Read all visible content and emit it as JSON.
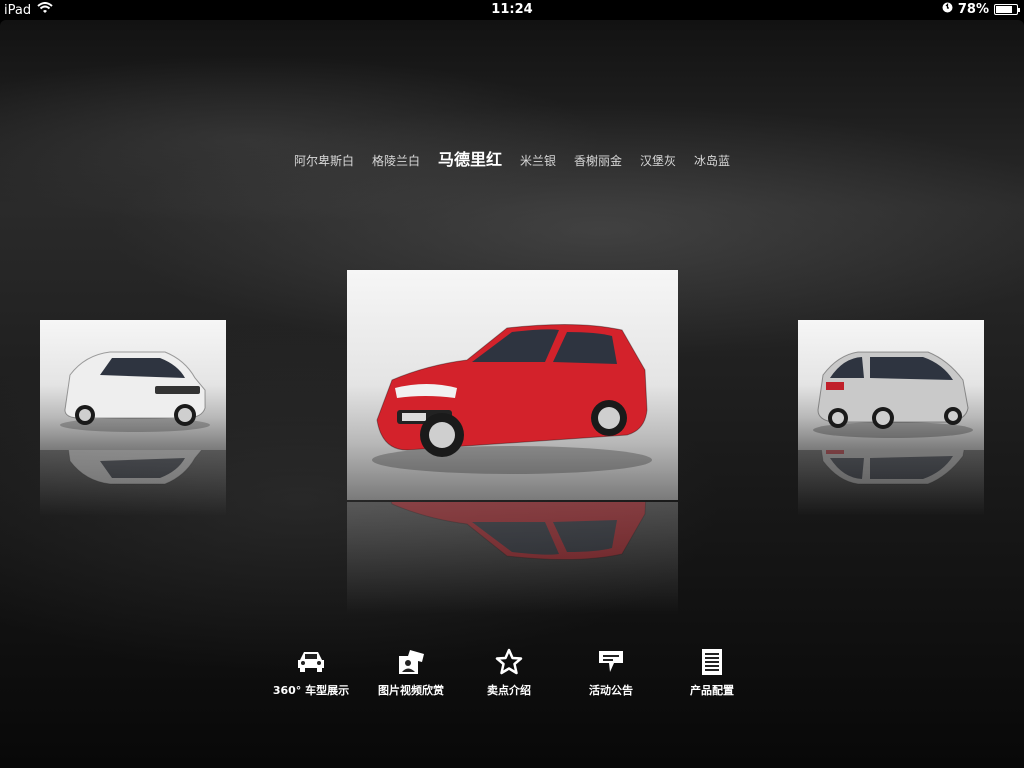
{
  "status_bar": {
    "device": "iPad",
    "time": "11:24",
    "battery_pct": 78,
    "battery_label": "78%"
  },
  "color_options": [
    {
      "label": "阿尔卑斯白",
      "active": false
    },
    {
      "label": "格陵兰白",
      "active": false
    },
    {
      "label": "马德里红",
      "active": true
    },
    {
      "label": "米兰银",
      "active": false
    },
    {
      "label": "香榭丽金",
      "active": false
    },
    {
      "label": "汉堡灰",
      "active": false
    },
    {
      "label": "冰岛蓝",
      "active": false
    }
  ],
  "carousel": {
    "left": {
      "car_color": "#eeeeee"
    },
    "center": {
      "car_color": "#d3222b"
    },
    "right": {
      "car_color": "#c9c9c9"
    }
  },
  "menu": [
    {
      "label": "360° 车型展示",
      "icon": "car-icon"
    },
    {
      "label": "图片视频欣赏",
      "icon": "photo-icon"
    },
    {
      "label": "卖点介绍",
      "icon": "star-icon"
    },
    {
      "label": "活动公告",
      "icon": "announcement-icon"
    },
    {
      "label": "产品配置",
      "icon": "list-icon"
    }
  ]
}
